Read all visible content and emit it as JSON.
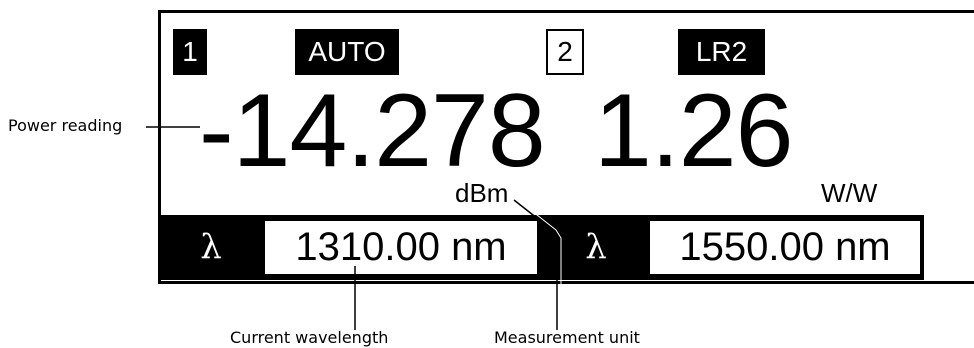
{
  "channel1": {
    "number": "1",
    "mode": "AUTO",
    "reading": "-14.278",
    "unit": "dBm",
    "lambda_symbol": "λ",
    "wavelength": "1310.00 nm"
  },
  "channel2": {
    "number": "2",
    "mode": "LR2",
    "reading": "1.26",
    "unit": "W/W",
    "lambda_symbol": "λ",
    "wavelength": "1550.00 nm"
  },
  "callouts": {
    "power_reading": "Power reading",
    "current_wavelength": "Current wavelength",
    "measurement_unit": "Measurement unit"
  },
  "colors": {
    "foreground": "#000000",
    "background": "#ffffff"
  }
}
